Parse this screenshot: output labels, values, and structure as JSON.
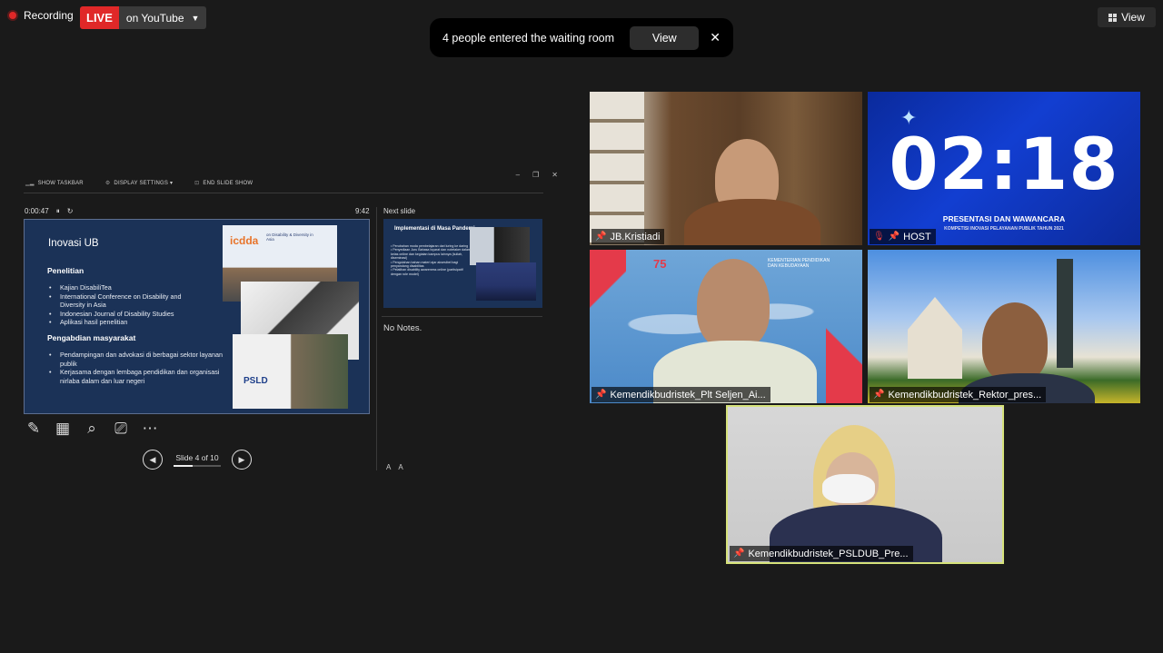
{
  "top_bar": {
    "recording_label": "Recording",
    "live_label": "LIVE",
    "stream_label": "on YouTube",
    "view_label": "View"
  },
  "notification": {
    "text": "4 people entered the waiting room",
    "button_label": "View",
    "close_glyph": "✕"
  },
  "presenter": {
    "toolbar": {
      "taskbar": "SHOW TASKBAR",
      "display": "DISPLAY SETTINGS ▾",
      "end": "END SLIDE SHOW"
    },
    "elapsed": "0:00:47",
    "clock": "9:42",
    "next_label": "Next slide",
    "notes": "No Notes.",
    "slide_counter": "Slide 4 of 10",
    "slide_progress": 0.4,
    "current_slide": {
      "title": "Inovasi UB",
      "section1": "Penelitian",
      "items1": [
        "Kajian DisabiliTea",
        "International Conference on Disability and Diversity in Asia",
        "Indonesian Journal of Disability Studies",
        "Aplikasi hasil penelitian"
      ],
      "section2": "Pengabdian masyarakat",
      "items2": [
        "Pendampingan dan advokasi di berbagai sektor layanan publik",
        "Kerjasama dengan lembaga pendidikan dan organisasi nirlaba dalam dan luar negeri"
      ],
      "photo_logo": "icdda",
      "photo_caption": "on Disability & Diversity in Asia",
      "photo_logo2": "PSLD"
    },
    "next_slide": {
      "title": "Implementasi di Masa Pandemi",
      "items": [
        "Perubahan moda pembelajaran dari luring ke daring",
        "Penyediaan Juru Bahasa Isyarat dan notetaker dalam kelas online dan kegiatan kampus lainnya (kuliah, diseminasi)",
        "Pengolahan bahan materi ajar aksesibel bagi penyandang disabilitas",
        "Pelatihan disability awareness online (partisipatif dengan role model)"
      ]
    },
    "font_buttons": [
      "A",
      "A"
    ]
  },
  "participants": [
    {
      "name": "JB.Kristiadi",
      "muted": false
    },
    {
      "name": "HOST",
      "muted": true
    },
    {
      "name": "Kemendikbudristek_Plt Seljen_Ai...",
      "muted": false
    },
    {
      "name": "Kemendikbudristek_Rektor_pres...",
      "muted": false
    },
    {
      "name": "Kemendikbudristek_PSLDUB_Pre...",
      "muted": false
    }
  ],
  "host_screen": {
    "countdown": "02:18",
    "line1": "PRESENTASI DAN WAWANCARA",
    "line2": "KOMPETISI INOVASI PELAYANAN PUBLIK TAHUN 2021"
  },
  "tile3": {
    "logo": "75",
    "ministry": "KEMENTERIAN PENDIDIKAN DAN KEBUDAYAAN"
  },
  "icons": {
    "pin": "pin-icon",
    "mic_off": "mic-off-icon"
  },
  "colors": {
    "live": "#e02828",
    "active_speaker_border": "#d6e27a",
    "slide_bg": "#1b3257"
  }
}
